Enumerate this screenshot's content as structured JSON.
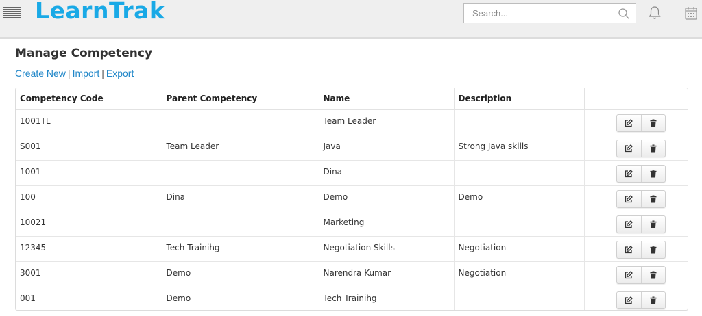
{
  "app": {
    "logo": "LearnTrak"
  },
  "search": {
    "placeholder": "Search..."
  },
  "page": {
    "title": "Manage Competency",
    "actions": {
      "create_new": "Create New",
      "import": "Import",
      "export": "Export",
      "separator": "|"
    }
  },
  "table": {
    "headers": [
      "Competency Code",
      "Parent Competency",
      "Name",
      "Description",
      ""
    ],
    "rows": [
      {
        "code": "1001TL",
        "parent": "",
        "name": "Team Leader",
        "description": ""
      },
      {
        "code": "S001",
        "parent": "Team Leader",
        "name": "Java",
        "description": "Strong Java skills"
      },
      {
        "code": "1001",
        "parent": "",
        "name": "Dina",
        "description": ""
      },
      {
        "code": "100",
        "parent": "Dina",
        "name": "Demo",
        "description": "Demo"
      },
      {
        "code": "10021",
        "parent": "",
        "name": "Marketing",
        "description": ""
      },
      {
        "code": "12345",
        "parent": "Tech Trainihg",
        "name": "Negotiation Skills",
        "description": "Negotiation"
      },
      {
        "code": "3001",
        "parent": "Demo",
        "name": "Narendra Kumar",
        "description": "Negotiation"
      },
      {
        "code": "001",
        "parent": "Demo",
        "name": "Tech Trainihg",
        "description": ""
      }
    ],
    "row_actions": {
      "edit_icon": "edit-icon",
      "delete_icon": "trash-icon"
    }
  },
  "colors": {
    "brand": "#19a9e6",
    "link": "#1f86c8",
    "header_bg": "#efefef"
  },
  "icons": {
    "menu": "hamburger-icon",
    "search": "search-icon",
    "notifications": "bell-icon",
    "calendar": "calendar-icon"
  }
}
